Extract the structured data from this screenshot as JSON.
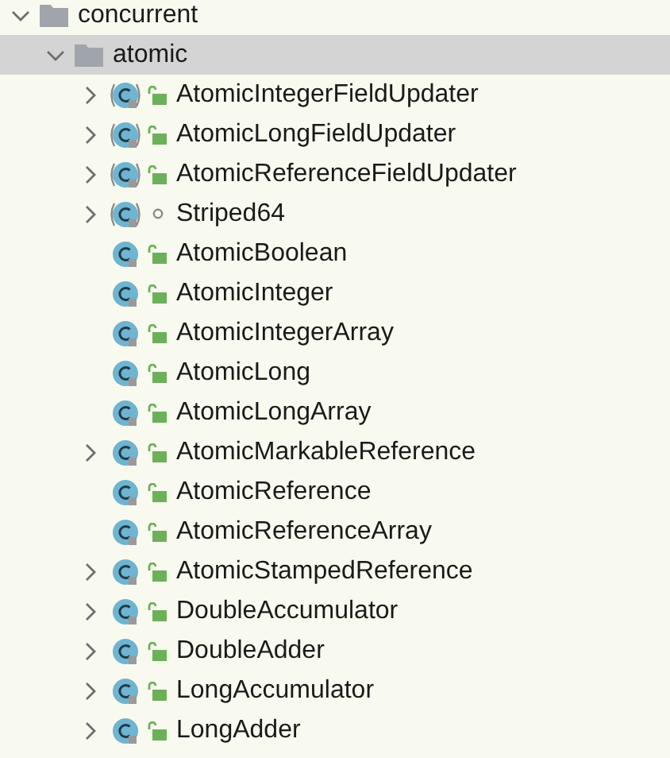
{
  "tree": [
    {
      "kind": "folder",
      "label": "concurrent",
      "expanded": true,
      "selected": false,
      "children": [
        {
          "kind": "folder",
          "label": "atomic",
          "expanded": true,
          "selected": true,
          "children": [
            {
              "kind": "class",
              "label": "AtomicIntegerFieldUpdater",
              "abstract": true,
              "public": true,
              "expandable": true
            },
            {
              "kind": "class",
              "label": "AtomicLongFieldUpdater",
              "abstract": true,
              "public": true,
              "expandable": true
            },
            {
              "kind": "class",
              "label": "AtomicReferenceFieldUpdater",
              "abstract": true,
              "public": true,
              "expandable": true
            },
            {
              "kind": "class",
              "label": "Striped64",
              "abstract": true,
              "public": false,
              "expandable": true
            },
            {
              "kind": "class",
              "label": "AtomicBoolean",
              "abstract": false,
              "public": true,
              "expandable": false
            },
            {
              "kind": "class",
              "label": "AtomicInteger",
              "abstract": false,
              "public": true,
              "expandable": false
            },
            {
              "kind": "class",
              "label": "AtomicIntegerArray",
              "abstract": false,
              "public": true,
              "expandable": false
            },
            {
              "kind": "class",
              "label": "AtomicLong",
              "abstract": false,
              "public": true,
              "expandable": false
            },
            {
              "kind": "class",
              "label": "AtomicLongArray",
              "abstract": false,
              "public": true,
              "expandable": false
            },
            {
              "kind": "class",
              "label": "AtomicMarkableReference",
              "abstract": false,
              "public": true,
              "expandable": true
            },
            {
              "kind": "class",
              "label": "AtomicReference",
              "abstract": false,
              "public": true,
              "expandable": false
            },
            {
              "kind": "class",
              "label": "AtomicReferenceArray",
              "abstract": false,
              "public": true,
              "expandable": false
            },
            {
              "kind": "class",
              "label": "AtomicStampedReference",
              "abstract": false,
              "public": true,
              "expandable": true
            },
            {
              "kind": "class",
              "label": "DoubleAccumulator",
              "abstract": false,
              "public": true,
              "expandable": true
            },
            {
              "kind": "class",
              "label": "DoubleAdder",
              "abstract": false,
              "public": true,
              "expandable": true
            },
            {
              "kind": "class",
              "label": "LongAccumulator",
              "abstract": false,
              "public": true,
              "expandable": true
            },
            {
              "kind": "class",
              "label": "LongAdder",
              "abstract": false,
              "public": true,
              "expandable": true
            }
          ]
        }
      ]
    }
  ]
}
